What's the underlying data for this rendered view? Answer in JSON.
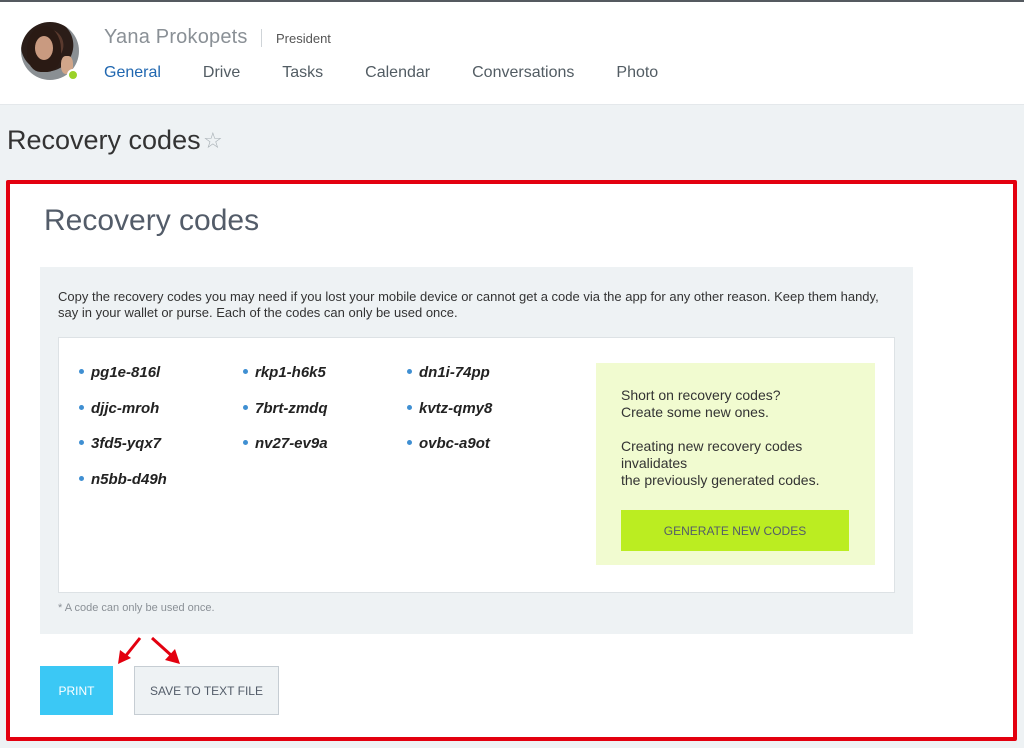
{
  "header": {
    "user_name": "Yana Prokopets",
    "user_role": "President",
    "tabs": [
      {
        "label": "General",
        "active": true
      },
      {
        "label": "Drive",
        "active": false
      },
      {
        "label": "Tasks",
        "active": false
      },
      {
        "label": "Calendar",
        "active": false
      },
      {
        "label": "Conversations",
        "active": false
      },
      {
        "label": "Photo",
        "active": false
      }
    ]
  },
  "page": {
    "title": "Recovery codes",
    "star_icon": "☆"
  },
  "card": {
    "title": "Recovery codes",
    "description": "Copy the recovery codes you may need if you lost your mobile device or cannot get a code via the app for any other reason. Keep them handy, say in your wallet or purse. Each of the codes can only be used once.",
    "codes": [
      "pg1e-816l",
      "rkp1-h6k5",
      "dn1i-74pp",
      "djjc-mroh",
      "7brt-zmdq",
      "kvtz-qmy8",
      "3fd5-yqx7",
      "nv27-ev9a",
      "ovbc-a9ot",
      "n5bb-d49h"
    ],
    "generate": {
      "line1": "Short on recovery codes?",
      "line2": "Create some new ones.",
      "line3": "Creating new recovery codes invalidates",
      "line4": "the previously generated codes.",
      "button_label": "GENERATE NEW CODES"
    },
    "footnote": "* A code can only be used once.",
    "print_label": "PRINT",
    "save_label": "SAVE TO TEXT FILE"
  },
  "colors": {
    "accent_blue": "#2067b0",
    "highlight_red": "#e3000f",
    "print_button": "#3bc8f5",
    "generate_button": "#bbed21",
    "online": "#9bd228"
  }
}
